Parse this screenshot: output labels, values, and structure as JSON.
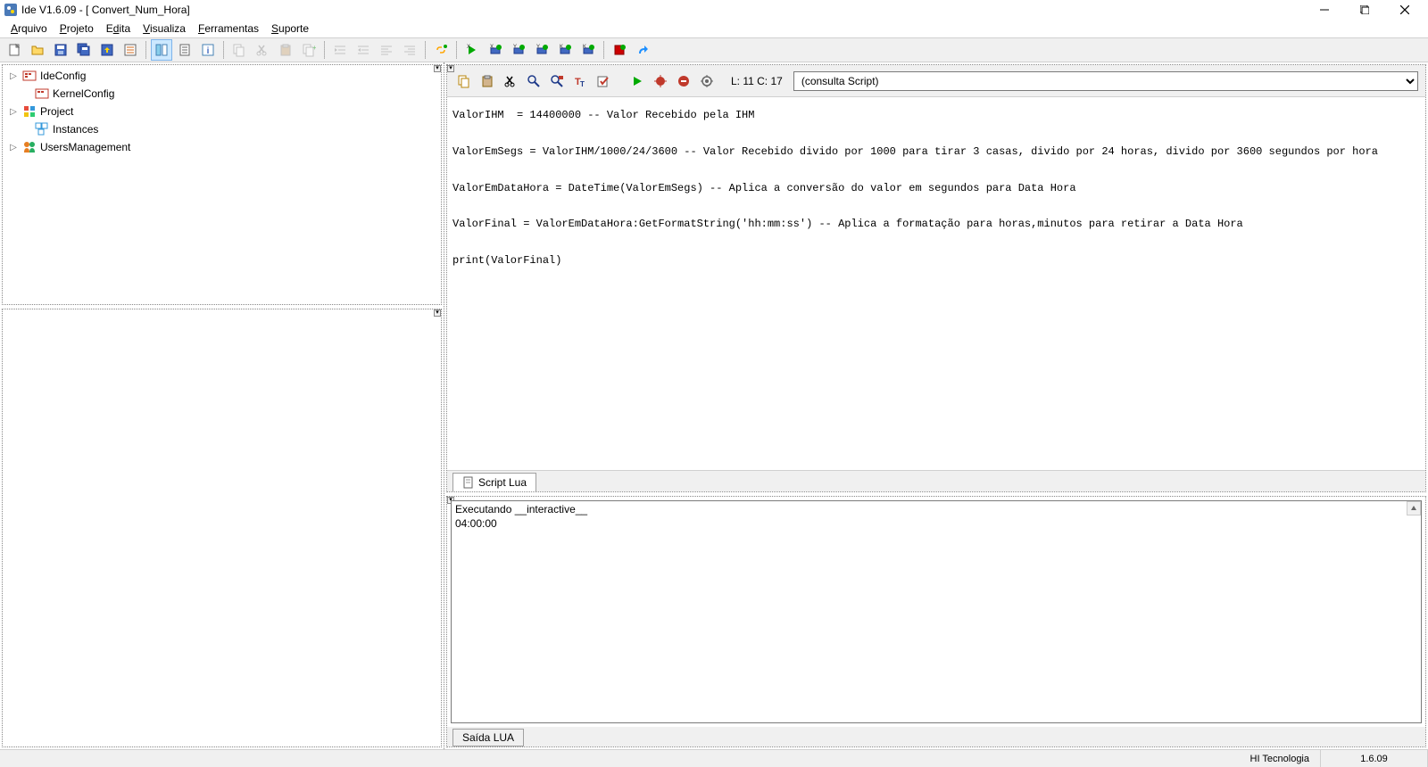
{
  "titlebar": {
    "title": "Ide V1.6.09  - [ Convert_Num_Hora]"
  },
  "menu": {
    "arquivo": "Arquivo",
    "projeto": "Projeto",
    "edita": "Edita",
    "visualiza": "Visualiza",
    "ferramentas": "Ferramentas",
    "suporte": "Suporte"
  },
  "tree": {
    "items": [
      {
        "label": "IdeConfig",
        "expandable": true
      },
      {
        "label": "KernelConfig",
        "expandable": false
      },
      {
        "label": "Project",
        "expandable": true
      },
      {
        "label": "Instances",
        "expandable": false
      },
      {
        "label": "UsersManagement",
        "expandable": true
      }
    ]
  },
  "editor": {
    "cursor_label": "L: 11 C: 17",
    "search_value": "(consulta Script)",
    "code_lines": [
      "ValorIHM  = 14400000 -- Valor Recebido pela IHM",
      "",
      "ValorEmSegs = ValorIHM/1000/24/3600 -- Valor Recebido divido por 1000 para tirar 3 casas, divido por 24 horas, divido por 3600 segundos por hora",
      "",
      "ValorEmDataHora = DateTime(ValorEmSegs) -- Aplica a conversão do valor em segundos para Data Hora",
      "",
      "ValorFinal = ValorEmDataHora:GetFormatString('hh:mm:ss') -- Aplica a formatação para horas,minutos para retirar a Data Hora",
      "",
      "print(ValorFinal)"
    ],
    "tab_label": "Script Lua"
  },
  "output": {
    "lines": [
      "Executando __interactive__",
      "04:00:00"
    ],
    "tab_label": "Saída LUA"
  },
  "statusbar": {
    "company": "HI Tecnologia",
    "version": "1.6.09"
  }
}
